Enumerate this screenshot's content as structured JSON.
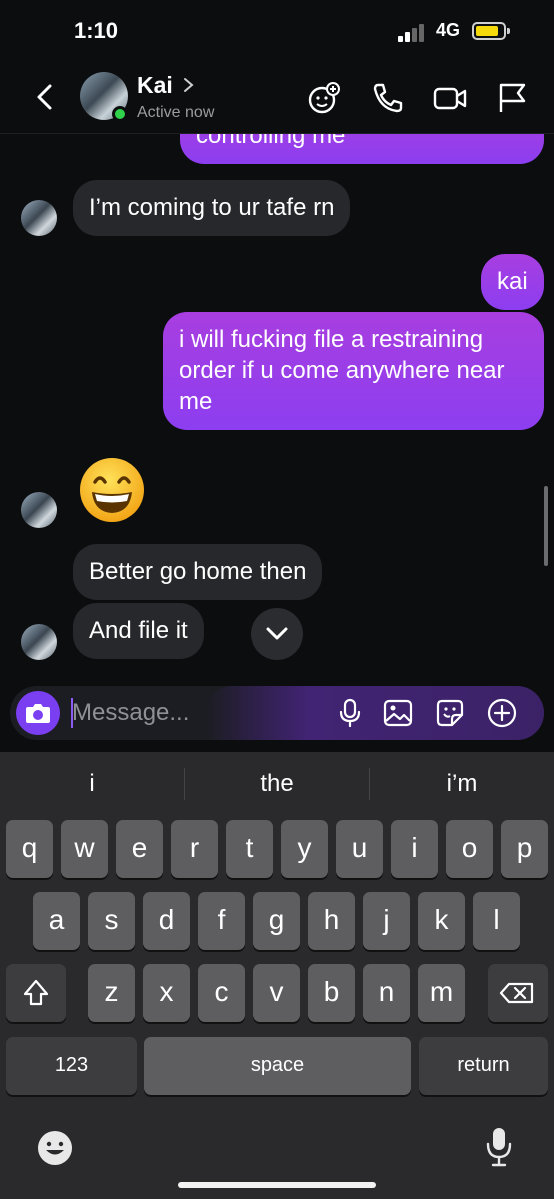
{
  "status_bar": {
    "time": "1:10",
    "network": "4G"
  },
  "header": {
    "name": "Kai",
    "status": "Active now"
  },
  "messages": [
    {
      "from": "me",
      "text": "controlling me"
    },
    {
      "from": "them",
      "text": "I’m coming to ur tafe rn"
    },
    {
      "from": "me",
      "text": "kai"
    },
    {
      "from": "me",
      "text": "i will fucking file a restraining order if u come anywhere near me"
    },
    {
      "from": "them",
      "text": "Better go home then"
    },
    {
      "from": "them",
      "text": "And file it"
    }
  ],
  "composer": {
    "placeholder": "Message..."
  },
  "keyboard": {
    "suggestions": [
      "i",
      "the",
      "i’m"
    ],
    "row1": [
      "q",
      "w",
      "e",
      "r",
      "t",
      "y",
      "u",
      "i",
      "o",
      "p"
    ],
    "row2": [
      "a",
      "s",
      "d",
      "f",
      "g",
      "h",
      "j",
      "k",
      "l"
    ],
    "row3": [
      "z",
      "x",
      "c",
      "v",
      "b",
      "n",
      "m"
    ],
    "numbers_label": "123",
    "space_label": "space",
    "return_label": "return"
  },
  "colors": {
    "outgoing": "#9a3ee8",
    "incoming": "#26282c",
    "accent": "#7b3ff2",
    "online": "#2fd24a"
  },
  "icons": [
    "back-icon",
    "effects-icon",
    "phone-icon",
    "video-icon",
    "flag-icon",
    "camera-icon",
    "mic-icon",
    "gallery-icon",
    "sticker-icon",
    "plus-icon",
    "emoji-icon",
    "shift-icon",
    "delete-icon",
    "keyboard-emoji-icon",
    "dictation-icon"
  ]
}
